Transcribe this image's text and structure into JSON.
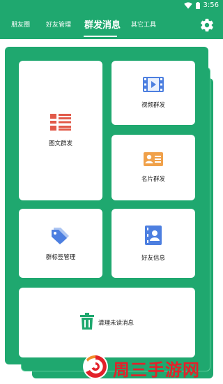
{
  "status_bar": {
    "time": "3:56"
  },
  "tabs": [
    {
      "label": "朋友圈"
    },
    {
      "label": "好友管理"
    },
    {
      "label": "群发消息"
    },
    {
      "label": "其它工具"
    }
  ],
  "active_tab": "群发消息",
  "cards": {
    "image_text": "图文群发",
    "video": "视频群发",
    "name_card": "名片群发",
    "tag_manage": "群标签管理",
    "friend_info": "好友信息",
    "clean_unread": "清理未读消息"
  },
  "watermark": {
    "text": "周三手游网"
  },
  "colors": {
    "primary_green": "#1fa86f",
    "icon_red": "#e25a4a",
    "icon_blue": "#4d7fe0",
    "icon_orange": "#f0a14a",
    "icon_green": "#1fa86f",
    "watermark_red": "#e3212a"
  }
}
